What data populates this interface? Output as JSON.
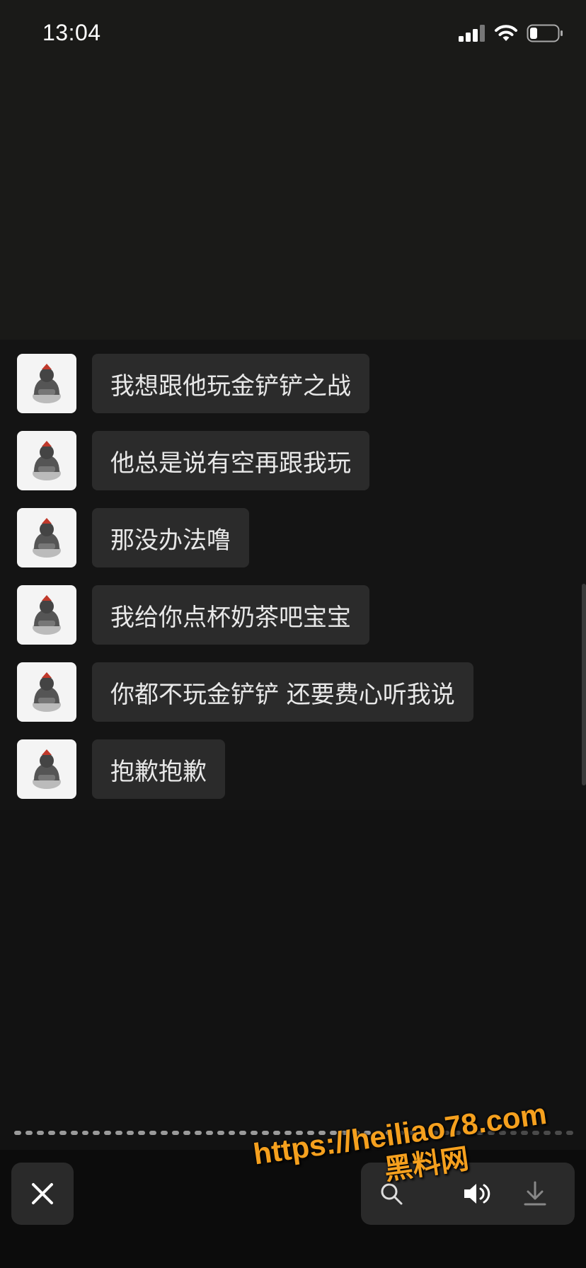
{
  "status_bar": {
    "time": "13:04"
  },
  "messages": [
    {
      "text": "我想跟他玩金铲铲之战"
    },
    {
      "text": "他总是说有空再跟我玩"
    },
    {
      "text": "那没办法噜"
    },
    {
      "text": "我给你点杯奶茶吧宝宝"
    },
    {
      "text": "你都不玩金铲铲 还要费心听我说"
    },
    {
      "text": "抱歉抱歉"
    }
  ],
  "progress": {
    "fraction": 0.68
  },
  "toolbar": {
    "close_icon": "close-icon",
    "icons": [
      "search-icon",
      "speaker-icon",
      "download-icon"
    ]
  },
  "watermark": {
    "url": "https://heiliao78.com",
    "name": "黑料网"
  },
  "colors": {
    "bubble": "#2b2b2b",
    "watermark": "#f5a01e"
  }
}
